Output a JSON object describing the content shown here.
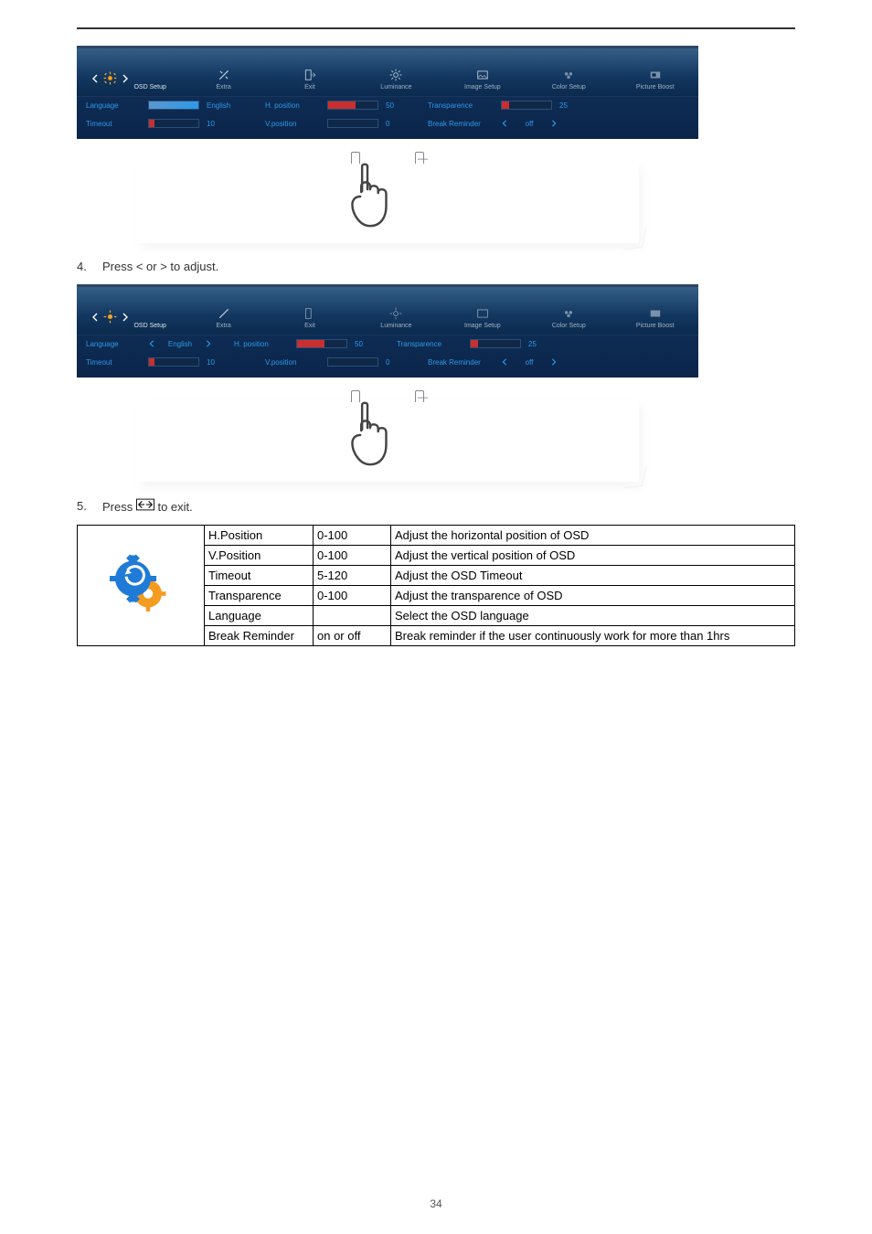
{
  "top_rule": true,
  "osd_tabs": [
    {
      "id": "osd-setup",
      "label": "OSD Setup",
      "active": true
    },
    {
      "id": "extra",
      "label": "Extra"
    },
    {
      "id": "exit",
      "label": "Exit"
    },
    {
      "id": "luminance",
      "label": "Luminance"
    },
    {
      "id": "image-setup",
      "label": "Image Setup"
    },
    {
      "id": "color-setup",
      "label": "Color Setup"
    },
    {
      "id": "picture-boost",
      "label": "Picture Boost"
    }
  ],
  "panel1": {
    "rows": [
      {
        "label": "Language",
        "value": "English",
        "slider_fill": 100,
        "slider_hl": true
      },
      {
        "label": "Timeout",
        "value": "10",
        "slider_fill": 12,
        "slider_hl": false
      }
    ],
    "middle": [
      {
        "label": "H. position",
        "value": "50",
        "slider_fill": 55
      },
      {
        "label": "V.position",
        "value": "0",
        "slider_fill": 0
      }
    ],
    "right": [
      {
        "label": "Transparence",
        "value": "25",
        "slider_fill": 15
      },
      {
        "label": "Break Reminder",
        "value": "off",
        "slider_fill": 0,
        "arrows": true
      }
    ]
  },
  "panel2": {
    "rows": [
      {
        "label": "Language",
        "value": "English",
        "slider_fill": 0,
        "arrows": true
      },
      {
        "label": "Timeout",
        "value": "10",
        "slider_fill": 12
      }
    ],
    "middle": [
      {
        "label": "H. position",
        "value": "50",
        "slider_fill": 55
      },
      {
        "label": "V.position",
        "value": "0",
        "slider_fill": 0
      }
    ],
    "right": [
      {
        "label": "Transparence",
        "value": "25",
        "slider_fill": 15
      },
      {
        "label": "Break Reminder",
        "value": "off",
        "slider_fill": 0,
        "arrows": true
      }
    ]
  },
  "step4": {
    "number": "4.",
    "text_a": "Press < or > to adjust."
  },
  "step5": {
    "number": "5.",
    "text_a": "Press ",
    "text_b": " to exit."
  },
  "table": {
    "rows": [
      {
        "name": "H.Position",
        "range": "0-100",
        "desc": "Adjust the horizontal position of OSD"
      },
      {
        "name": "V.Position",
        "range": "0-100",
        "desc": "Adjust the vertical position of OSD"
      },
      {
        "name": "Timeout",
        "range": "5-120",
        "desc": "Adjust the OSD Timeout"
      },
      {
        "name": "Transparence",
        "range": "0-100",
        "desc": "Adjust the transparence of OSD"
      },
      {
        "name": "Language",
        "range": "",
        "desc": "Select the OSD language"
      },
      {
        "name": "Break Reminder",
        "range": "on or off",
        "desc": "Break reminder if the user continuously work for more than 1hrs"
      }
    ]
  },
  "page_number": "34"
}
